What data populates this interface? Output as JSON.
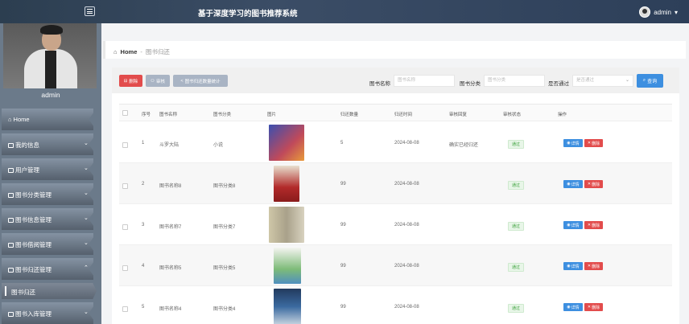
{
  "header": {
    "title": "基于深度学习的图书推荐系统",
    "user": "admin"
  },
  "sidebar": {
    "profile_name": "admin",
    "items": [
      {
        "label": "Home",
        "icon": "home-icon"
      },
      {
        "label": "我的信息",
        "icon": "profile-icon"
      },
      {
        "label": "用户管理",
        "icon": "grid-icon"
      },
      {
        "label": "图书分类管理",
        "icon": "folder-icon"
      },
      {
        "label": "图书信息管理",
        "icon": "grid-icon"
      },
      {
        "label": "图书借阅管理",
        "icon": "user-icon"
      },
      {
        "label": "图书归还管理",
        "icon": "folder-icon"
      },
      {
        "label": "图书入库管理",
        "icon": "book-icon"
      }
    ],
    "sub_item": "图书归还"
  },
  "breadcrumb": {
    "home": "Home",
    "separator": "-",
    "current": "图书归还"
  },
  "toolbar": {
    "delete_label": "删除",
    "audit_label": "审核",
    "stats_label": "图书归还数量统计",
    "filters": [
      {
        "label": "图书名称",
        "placeholder": "图书名称"
      },
      {
        "label": "图书分类",
        "placeholder": "图书分类"
      },
      {
        "label": "是否通过",
        "placeholder": "是否通过"
      }
    ],
    "search_label": "查询"
  },
  "table": {
    "headers": [
      "序号",
      "图书名称",
      "图书分类",
      "图片",
      "归还数量",
      "归还时间",
      "审核回复",
      "审核状态",
      "操作"
    ],
    "rows": [
      {
        "index": "1",
        "name": "斗罗大陆",
        "category": "小说",
        "qty": "5",
        "time": "2024-08-08",
        "reply": "确实已经归还",
        "status": "通过",
        "cover_color": "#c04a5a"
      },
      {
        "index": "2",
        "name": "图书名称8",
        "category": "图书分类8",
        "qty": "99",
        "time": "2024-08-08",
        "reply": "",
        "status": "通过",
        "cover_color": "#b22a2a"
      },
      {
        "index": "3",
        "name": "图书名称7",
        "category": "图书分类7",
        "qty": "99",
        "time": "2024-08-08",
        "reply": "",
        "status": "通过",
        "cover_color": "#cfc7a8"
      },
      {
        "index": "4",
        "name": "图书名称5",
        "category": "图书分类5",
        "qty": "99",
        "time": "2024-08-08",
        "reply": "",
        "status": "通过",
        "cover_color": "#7dbb78"
      },
      {
        "index": "5",
        "name": "图书名称4",
        "category": "图书分类4",
        "qty": "99",
        "time": "2024-08-08",
        "reply": "",
        "status": "通过",
        "cover_color": "#3b6aa0"
      }
    ],
    "detail_label": "详情",
    "delete_label": "删除"
  },
  "colors": {
    "topbar": "#2c3e50",
    "primary": "#3d8fe0",
    "danger": "#e24c4c",
    "success": "#3aa03a"
  }
}
